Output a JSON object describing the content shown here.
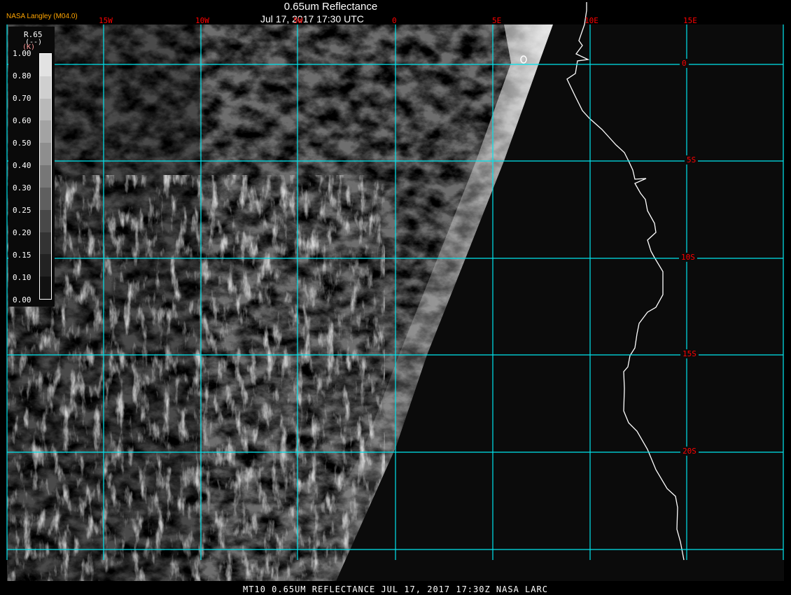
{
  "header": {
    "title": "0.65um Reflectance",
    "datetime": "Jul 17, 2017 17:30 UTC",
    "credit": "NASA Langley (M04.0)"
  },
  "legend": {
    "variable": "R.65",
    "units": "(--)",
    "k_label": "(K)",
    "labels": [
      "1.00",
      "0.80",
      "0.70",
      "0.60",
      "0.50",
      "0.40",
      "0.30",
      "0.25",
      "0.20",
      "0.15",
      "0.10",
      "0.00"
    ],
    "colors": [
      "#ffffff",
      "#e2e2e2",
      "#cfcfcf",
      "#b9b9b9",
      "#a3a3a3",
      "#8e8e8e",
      "#777777",
      "#5f5f5f",
      "#484848",
      "#333333",
      "#222222",
      "#111111"
    ]
  },
  "grid": {
    "longitudes": [
      "15W",
      "10W",
      "5W",
      "0",
      "5E",
      "10E",
      "15E"
    ],
    "latitudes": [
      "0",
      "5S",
      "10S",
      "15S",
      "20S"
    ],
    "line_color": "#00e5ee",
    "label_color": "#ff0000"
  },
  "footer": {
    "caption": "MT10  0.65UM REFLECTANCE   JUL 17, 2017 17:30Z   NASA LARC"
  }
}
